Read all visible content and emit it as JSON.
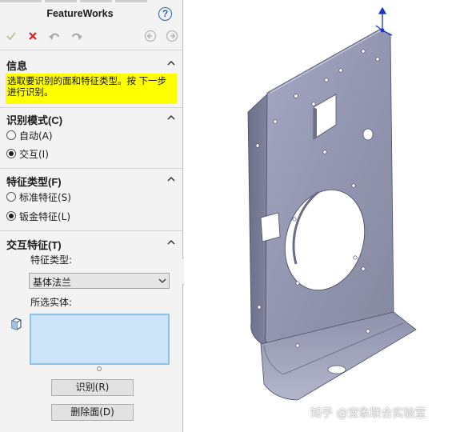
{
  "panel": {
    "title": "FeatureWorks",
    "help_glyph": "?",
    "toolbar": {
      "ok_icon": "check-icon",
      "cancel_icon": "close-icon",
      "undo_icon": "undo-icon",
      "redo_icon": "redo-icon",
      "back_icon": "back-arrow-icon",
      "next_icon": "next-arrow-icon"
    },
    "info": {
      "heading": "信息",
      "message": "选取要识别的面和特征类型。按 下一步 进行识别。",
      "highlight_color": "#ffff00"
    },
    "recognition_mode": {
      "heading": "识别模式(C)",
      "options": [
        {
          "label": "自动(A)",
          "checked": false
        },
        {
          "label": "交互(I)",
          "checked": true
        }
      ]
    },
    "feature_type": {
      "heading": "特征类型(F)",
      "options": [
        {
          "label": "标准特征(S)",
          "checked": false
        },
        {
          "label": "钣金特征(L)",
          "checked": true
        }
      ]
    },
    "interactive_features": {
      "heading": "交互特征(T)",
      "feature_type_label": "特征类型:",
      "feature_type_value": "基体法兰",
      "selected_entities_label": "所选实体:",
      "selection_box_color": "#cce4f7",
      "recognize_button": "识别(R)",
      "delete_faces_button": "删除面(D)"
    }
  },
  "viewport": {
    "model_color": "#8f93ad",
    "triad_color": "#1a33c8",
    "watermark": "知乎 @宝象联合实验室"
  }
}
